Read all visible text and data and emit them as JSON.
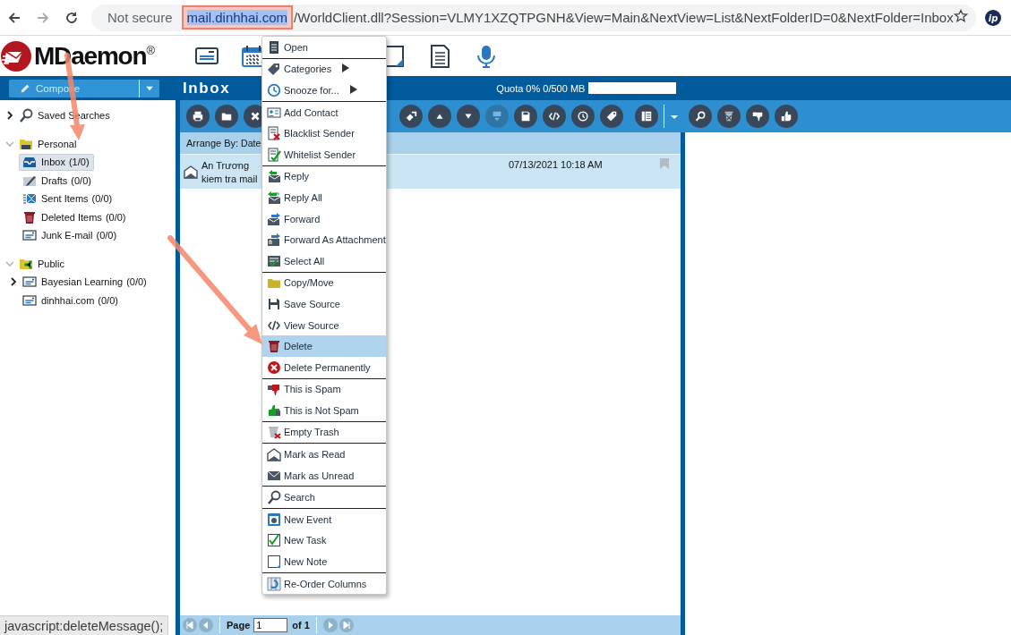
{
  "browser": {
    "security_label": "Not secure",
    "url_host": "mail.dinhhai.com",
    "url_host_highlighted": true,
    "url_rest": "/WorldClient.dll?Session=VLMY1XZQTPGNH&View=Main&NextView=List&NextFolderID=0&NextFolder=Inbox",
    "extension_badge": "ip"
  },
  "app_header": {
    "logo": "MDaemon",
    "logo_mark": "®",
    "nav_icons": [
      {
        "kind": "mail"
      },
      {
        "kind": "calendar"
      },
      {
        "kind": "notes"
      },
      {
        "kind": "documents"
      },
      {
        "kind": "mic"
      }
    ]
  },
  "compose_button": {
    "label": "Compose"
  },
  "folder_header": {
    "title": "Inbox",
    "quota": "Quota 0% 0/500 MB",
    "level": 0
  },
  "sidebar": {
    "items": [
      {
        "label": "Saved Searches",
        "kind": "search",
        "expanded": false,
        "selected": false
      },
      {
        "label": "Personal",
        "kind": "personal",
        "expanded": true,
        "selected": false,
        "children": [
          {
            "label": "Inbox",
            "count": "(1/0)",
            "kind": "inbox",
            "selected": true
          },
          {
            "label": "Drafts",
            "count": "(0/0)",
            "kind": "drafts",
            "selected": false
          },
          {
            "label": "Sent Items",
            "count": "(0/0)",
            "kind": "sent",
            "selected": false
          },
          {
            "label": "Deleted Items",
            "count": "(0/0)",
            "kind": "trash",
            "selected": false
          },
          {
            "label": "Junk E-mail",
            "count": "(0/0)",
            "kind": "list",
            "selected": false
          }
        ]
      },
      {
        "label": "Public",
        "kind": "public",
        "expanded": true,
        "selected": false,
        "children": [
          {
            "label": "Bayesian Learning",
            "count": "(0/0)",
            "kind": "list",
            "expanded": false,
            "selected": false
          },
          {
            "label": "dinhhai.com",
            "count": "(0/0)",
            "kind": "list",
            "selected": false
          }
        ]
      }
    ]
  },
  "toolbar": {
    "left": [
      {
        "kind": "print",
        "disabled": false
      },
      {
        "kind": "folder",
        "disabled": false
      },
      {
        "kind": "delete",
        "disabled": false
      }
    ],
    "right": [
      {
        "kind": "forward",
        "disabled": false
      },
      {
        "kind": "up",
        "disabled": false
      },
      {
        "kind": "down",
        "disabled": false
      },
      {
        "kind": "filter",
        "disabled": true
      },
      {
        "kind": "save",
        "disabled": false
      },
      {
        "kind": "source",
        "disabled": false
      },
      {
        "kind": "snooze",
        "disabled": false
      },
      {
        "kind": "tag",
        "disabled": false
      },
      {
        "kind": "columns",
        "disabled": false
      },
      {
        "kind": "caret",
        "disabled": false
      },
      {
        "kind": "search",
        "disabled": false
      },
      {
        "kind": "junk",
        "disabled": false
      },
      {
        "kind": "thumbs-down",
        "disabled": false
      },
      {
        "kind": "thumbs-up",
        "disabled": false
      }
    ]
  },
  "message_list": {
    "arrange_label": "Arrange By:",
    "arrange_value": "Date",
    "messages": [
      {
        "sender": "An Trương",
        "subject": "kiem tra mail",
        "date": "07/13/2021 10:18 AM",
        "read": true,
        "selected": true,
        "flagged": false
      }
    ]
  },
  "pager": {
    "label": "Page",
    "value": "1",
    "total": "of 1"
  },
  "context_menu": {
    "sections": [
      {
        "items": [
          {
            "label": "Open",
            "kind": "open",
            "submenu": false,
            "selected": false
          }
        ]
      },
      {
        "items": [
          {
            "label": "Categories",
            "kind": "categories",
            "submenu": true,
            "selected": false
          },
          {
            "label": "Snooze for...",
            "kind": "snooze",
            "submenu": true,
            "selected": false
          }
        ]
      },
      {
        "items": [
          {
            "label": "Add Contact",
            "kind": "add-contact",
            "submenu": false,
            "selected": false
          },
          {
            "label": "Blacklist Sender",
            "kind": "blacklist",
            "submenu": false,
            "selected": false
          },
          {
            "label": "Whitelist Sender",
            "kind": "whitelist",
            "submenu": false,
            "selected": false
          }
        ]
      },
      {
        "items": [
          {
            "label": "Reply",
            "kind": "reply",
            "submenu": false,
            "selected": false
          },
          {
            "label": "Reply All",
            "kind": "reply-all",
            "submenu": false,
            "selected": false
          },
          {
            "label": "Forward",
            "kind": "forward",
            "submenu": false,
            "selected": false
          },
          {
            "label": "Forward As Attachment",
            "kind": "forward-attachment",
            "submenu": false,
            "selected": false
          },
          {
            "label": "Select All",
            "kind": "select-all",
            "submenu": false,
            "selected": false
          }
        ]
      },
      {
        "items": [
          {
            "label": "Copy/Move",
            "kind": "copy-move",
            "submenu": false,
            "selected": false
          },
          {
            "label": "Save Source",
            "kind": "save",
            "submenu": false,
            "selected": false
          },
          {
            "label": "View Source",
            "kind": "source",
            "submenu": false,
            "selected": false
          },
          {
            "label": "Delete",
            "kind": "delete",
            "submenu": false,
            "selected": true
          },
          {
            "label": "Delete Permanently",
            "kind": "delete-permanently",
            "submenu": false,
            "selected": false
          }
        ]
      },
      {
        "items": [
          {
            "label": "This is Spam",
            "kind": "spam",
            "submenu": false,
            "selected": false
          },
          {
            "label": "This is Not Spam",
            "kind": "not-spam",
            "submenu": false,
            "selected": false
          }
        ]
      },
      {
        "items": [
          {
            "label": "Empty Trash",
            "kind": "empty-trash",
            "submenu": false,
            "selected": false
          }
        ]
      },
      {
        "items": [
          {
            "label": "Mark as Read",
            "kind": "mark-read",
            "submenu": false,
            "selected": false
          },
          {
            "label": "Mark as Unread",
            "kind": "mark-unread",
            "submenu": false,
            "selected": false
          }
        ]
      },
      {
        "items": [
          {
            "label": "Search",
            "kind": "search",
            "submenu": false,
            "selected": false
          }
        ]
      },
      {
        "items": [
          {
            "label": "New Event",
            "kind": "event",
            "submenu": false,
            "selected": false
          },
          {
            "label": "New Task",
            "kind": "task",
            "submenu": false,
            "selected": false
          },
          {
            "label": "New Note",
            "kind": "note",
            "submenu": false,
            "selected": false
          }
        ]
      },
      {
        "items": [
          {
            "label": "Re-Order Columns",
            "kind": "reorder",
            "submenu": false,
            "selected": false
          }
        ]
      }
    ]
  },
  "status_text": "javascript:deleteMessage();",
  "annotations": [
    {
      "kind": "arrow"
    },
    {
      "kind": "arrow"
    }
  ]
}
